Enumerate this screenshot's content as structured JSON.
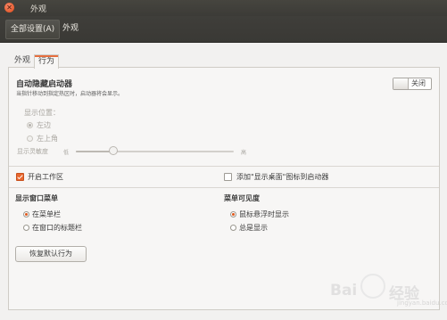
{
  "window": {
    "title": "外观"
  },
  "toolbar": {
    "all_settings": "全部设置(A)",
    "current": "外观"
  },
  "tabs": [
    {
      "label": "外观",
      "active": false
    },
    {
      "label": "行为",
      "active": true
    }
  ],
  "autohide": {
    "title": "自动隐藏启动器",
    "description": "当指针移动到指定热区时，启动器将会显示。",
    "toggle_label": "关闭",
    "toggle_on": false
  },
  "reveal_location": {
    "label": "显示位置：",
    "options": [
      {
        "label": "左边",
        "checked": true
      },
      {
        "label": "左上角",
        "checked": false
      }
    ]
  },
  "sensitivity": {
    "label": "显示灵敏度",
    "low": "低",
    "high": "高",
    "value": 0.24
  },
  "workspaces": {
    "label": "开启工作区",
    "checked": true
  },
  "show_desktop": {
    "label": "添加\"显示桌面\"图标到启动器",
    "checked": false
  },
  "window_menus": {
    "title": "显示窗口菜单",
    "options": [
      {
        "label": "在菜单栏",
        "checked": true
      },
      {
        "label": "在窗口的标题栏",
        "checked": false
      }
    ]
  },
  "menu_visibility": {
    "title": "菜单可见度",
    "options": [
      {
        "label": "鼠标悬浮时显示",
        "checked": true
      },
      {
        "label": "总是显示",
        "checked": false
      }
    ]
  },
  "reset_button": "恢复默认行为",
  "watermark": {
    "text_left": "Bai",
    "text_right": "经验",
    "url": "jingyan.baidu.com"
  },
  "colors": {
    "accent": "#e8672e",
    "titlebar": "#3c3b37"
  }
}
